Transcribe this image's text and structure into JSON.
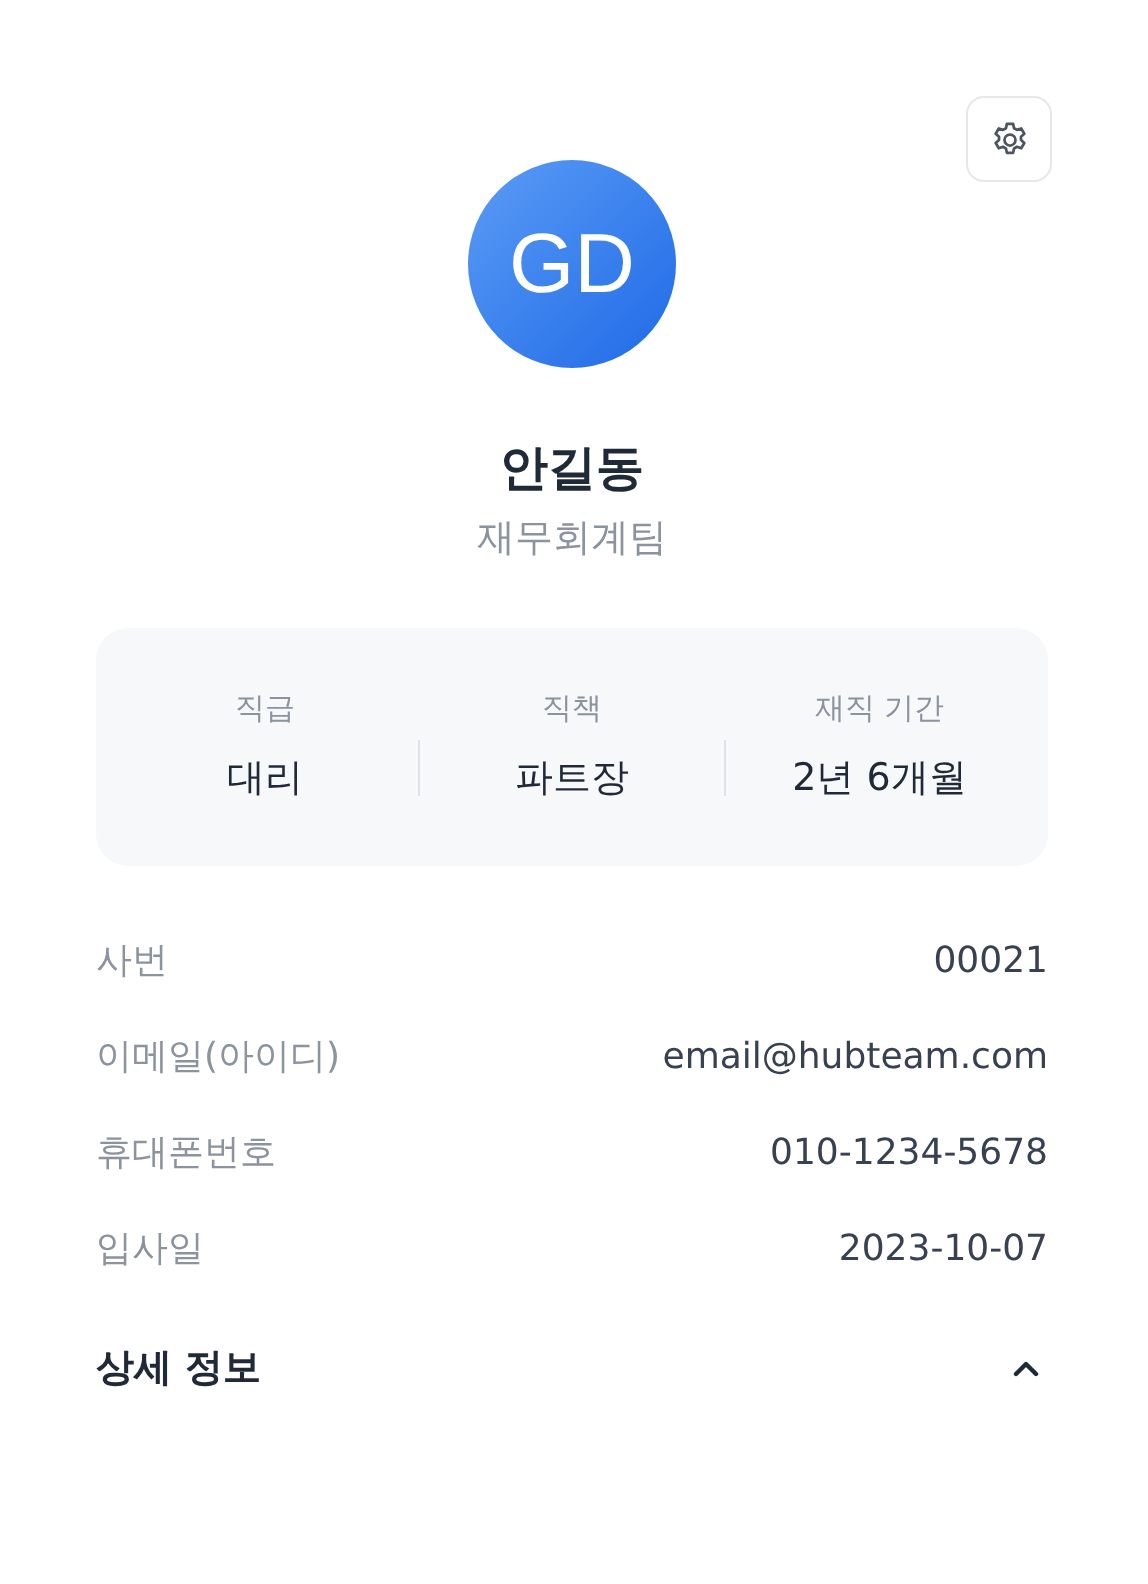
{
  "profile": {
    "initials": "GD",
    "name": "안길동",
    "team": "재무회계팀"
  },
  "stats": [
    {
      "label": "직급",
      "value": "대리"
    },
    {
      "label": "직책",
      "value": "파트장"
    },
    {
      "label": "재직 기간",
      "value": "2년 6개월"
    }
  ],
  "details": [
    {
      "label": "사번",
      "value": "00021"
    },
    {
      "label": "이메일(아이디)",
      "value": "email@hubteam.com"
    },
    {
      "label": "휴대폰번호",
      "value": "010-1234-5678"
    },
    {
      "label": "입사일",
      "value": "2023-10-07"
    }
  ],
  "section": {
    "title": "상세 정보",
    "expanded": true
  }
}
